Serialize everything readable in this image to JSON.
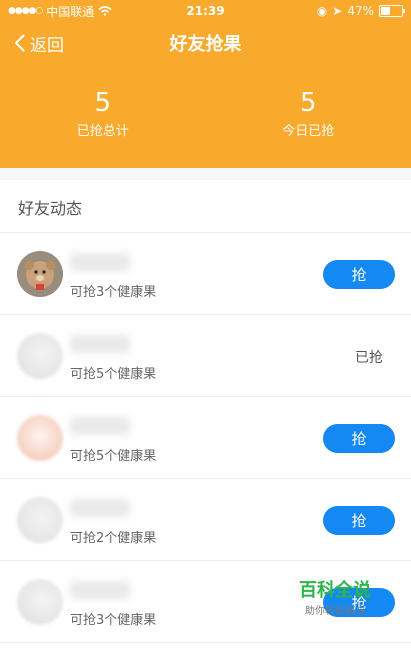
{
  "status": {
    "carrier": "中国联通",
    "time": "21:39",
    "battery": "47%",
    "battery_level": 0.47
  },
  "nav": {
    "back_label": "返回",
    "title": "好友抢果"
  },
  "stats": [
    {
      "value": "5",
      "label": "已抢总计"
    },
    {
      "value": "5",
      "label": "今日已抢"
    }
  ],
  "section": {
    "title": "好友动态"
  },
  "friends": [
    {
      "sub": "可抢3个健康果",
      "action": "抢",
      "grabbed": false
    },
    {
      "sub": "可抢5个健康果",
      "action": "已抢",
      "grabbed": true
    },
    {
      "sub": "可抢5个健康果",
      "action": "抢",
      "grabbed": false
    },
    {
      "sub": "可抢2个健康果",
      "action": "抢",
      "grabbed": false
    },
    {
      "sub": "可抢3个健康果",
      "action": "抢",
      "grabbed": false
    }
  ],
  "watermark": {
    "main": "百科全说",
    "sub": "助你轻松解决"
  }
}
